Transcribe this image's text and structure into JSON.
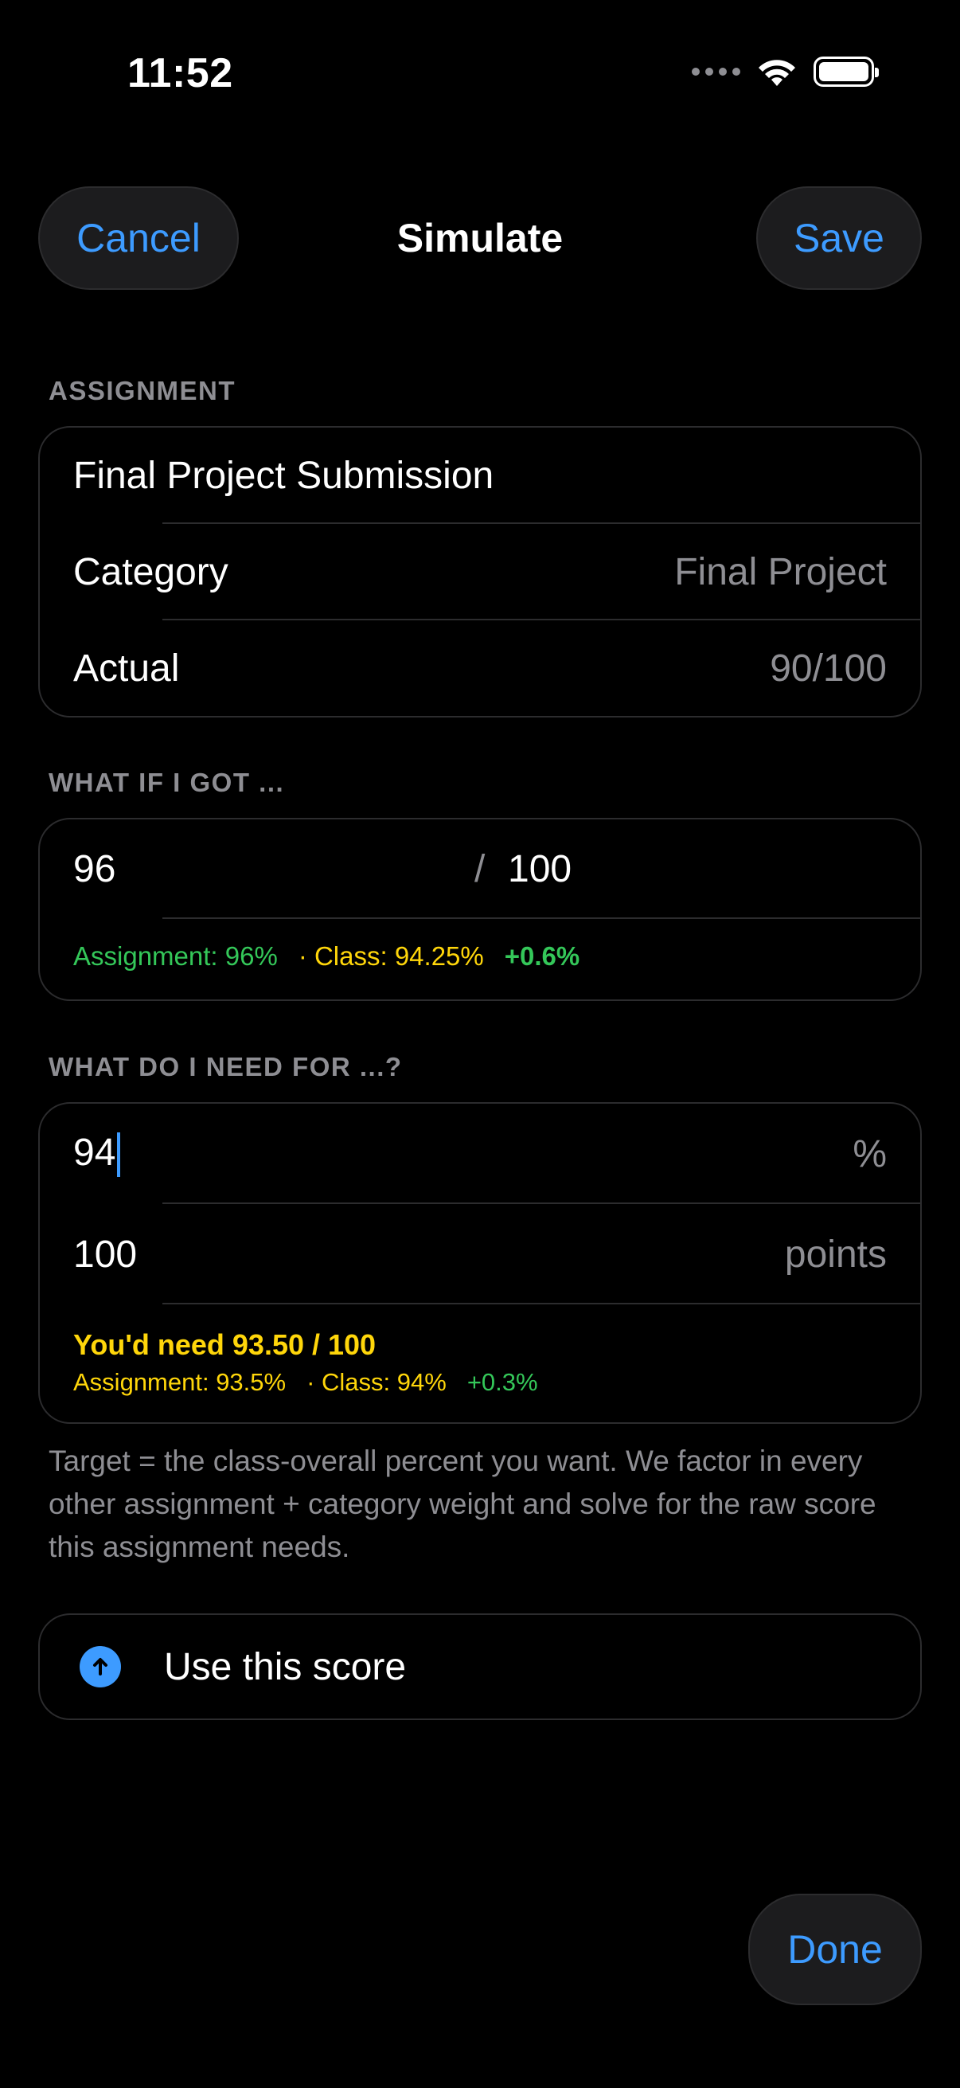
{
  "status_bar": {
    "time": "11:52"
  },
  "nav": {
    "cancel": "Cancel",
    "title": "Simulate",
    "save": "Save"
  },
  "assignment": {
    "header": "ASSIGNMENT",
    "name": "Final Project Submission",
    "category_label": "Category",
    "category_value": "Final Project",
    "actual_label": "Actual",
    "actual_value": "90/100"
  },
  "what_if": {
    "header": "WHAT IF I GOT ...",
    "score": "96",
    "slash": "/",
    "out_of": "100",
    "assignment_pct": "Assignment: 96%",
    "class_pct": "· Class: 94.25%",
    "delta": "+0.6%"
  },
  "need_for": {
    "header": "WHAT DO I NEED FOR ...?",
    "target": "94",
    "target_unit": "%",
    "points": "100",
    "points_unit": "points",
    "result": "You'd need 93.50 / 100",
    "assignment_pct": "Assignment: 93.5%",
    "class_pct": "· Class: 94%",
    "delta": "+0.3%"
  },
  "footnote": "Target = the class-overall percent you want. We factor in every other assignment + category weight and solve for the raw score this assignment needs.",
  "use_score": {
    "label": "Use this score",
    "icon": "arrow-up-circle-icon"
  },
  "done": "Done",
  "colors": {
    "accent": "#3d9bff",
    "positive": "#34c759",
    "warning": "#ffd60a",
    "secondary": "#8e8e93"
  }
}
